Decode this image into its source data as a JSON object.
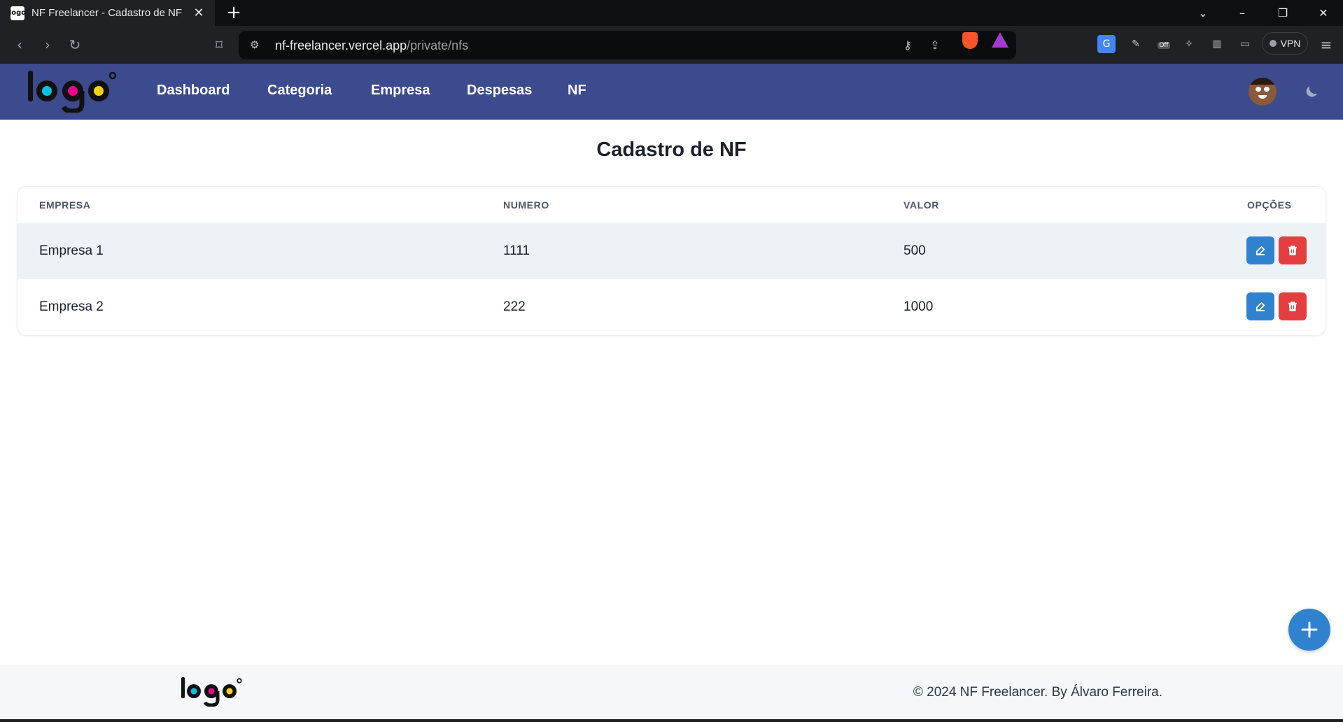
{
  "browser": {
    "tab_title": "NF Freelancer - Cadastro de NF",
    "favicon_text": "logo",
    "url_host": "nf-freelancer.vercel.app",
    "url_path": "/private/nfs",
    "vpn_label": "VPN",
    "ext_off_badge": "Off"
  },
  "navbar": {
    "logo_text": "logo",
    "items": [
      {
        "label": "Dashboard"
      },
      {
        "label": "Categoria"
      },
      {
        "label": "Empresa"
      },
      {
        "label": "Despesas"
      },
      {
        "label": "NF"
      }
    ]
  },
  "page": {
    "title": "Cadastro de NF"
  },
  "table": {
    "columns": [
      "EMPRESA",
      "NUMERO",
      "VALOR",
      "OPÇÕES"
    ],
    "rows": [
      {
        "empresa": "Empresa 1",
        "numero": "1111",
        "valor": "500"
      },
      {
        "empresa": "Empresa 2",
        "numero": "222",
        "valor": "1000"
      }
    ]
  },
  "footer": {
    "logo_text": "logo",
    "copyright": "© 2024 NF Freelancer. By Álvaro Ferreira."
  },
  "colors": {
    "navbar": "#3c4a8e",
    "edit_button": "#3182ce",
    "delete_button": "#e53e3e",
    "fab": "#3182ce",
    "logo_cyan": "#00c2e0",
    "logo_magenta": "#ec008c",
    "logo_yellow": "#f7d117"
  },
  "icons": {
    "edit": "edit-icon",
    "delete": "trash-icon",
    "add": "plus-icon",
    "theme": "moon-icon"
  }
}
